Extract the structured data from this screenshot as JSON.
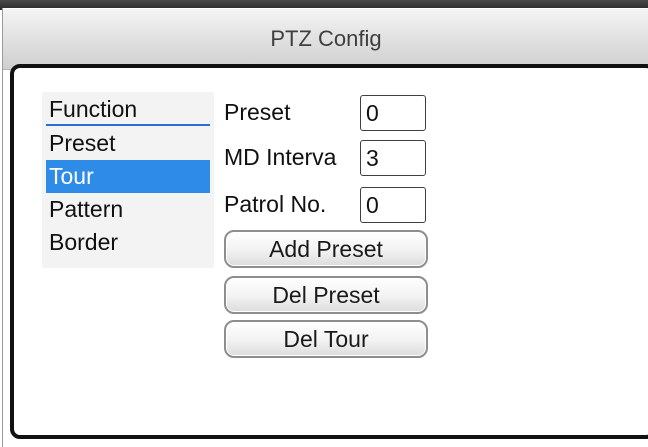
{
  "window": {
    "title": "PTZ Config"
  },
  "function_list": {
    "header": "Function",
    "items": [
      {
        "label": "Preset",
        "selected": false
      },
      {
        "label": "Tour",
        "selected": true
      },
      {
        "label": "Pattern",
        "selected": false
      },
      {
        "label": "Border",
        "selected": false
      }
    ]
  },
  "fields": {
    "preset": {
      "label": "Preset",
      "value": "0"
    },
    "md_interval": {
      "label": "MD Interva",
      "value": "3"
    },
    "patrol_no": {
      "label": "Patrol No.",
      "value": "0"
    }
  },
  "buttons": {
    "add_preset": "Add Preset",
    "del_preset": "Del Preset",
    "del_tour": "Del Tour"
  },
  "colors": {
    "selection": "#2f8be8",
    "header_underline": "#2b6cd8",
    "frame": "#111111"
  }
}
